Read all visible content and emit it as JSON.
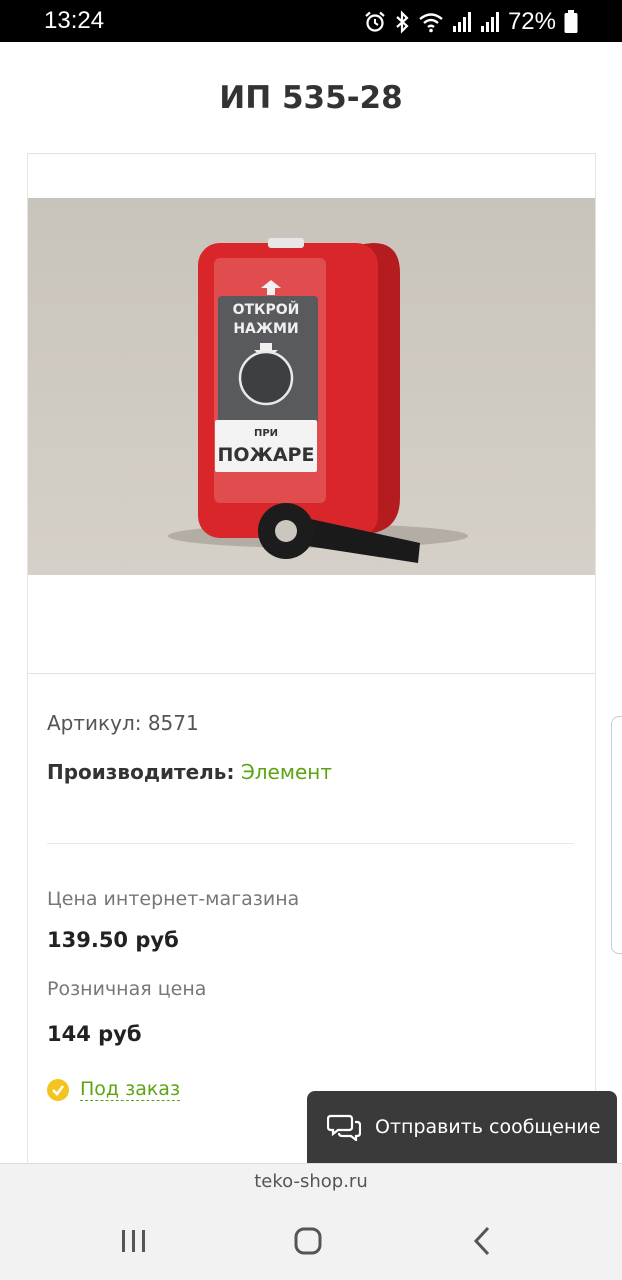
{
  "status_bar": {
    "time": "13:24",
    "battery_percent": "72%",
    "icons": [
      "alarm-icon",
      "bluetooth-icon",
      "wifi-icon",
      "signal-icon",
      "signal-icon",
      "battery-icon"
    ]
  },
  "product": {
    "title": "ИП 535-28",
    "image": {
      "label_top": "ОТКРОЙ",
      "label_middle": "НАЖМИ",
      "label_small": "ПРИ",
      "label_big": "ПОЖАРЕ"
    },
    "sku_text": "Артикул: 8571",
    "manufacturer_label": "Производитель:",
    "manufacturer_name": "Элемент",
    "price_online_label": "Цена интернет-магазина",
    "price_online": "139.50 руб",
    "price_retail_label": "Розничная цена",
    "price_retail": "144 руб",
    "availability": "Под заказ"
  },
  "chat": {
    "label": "Отправить сообщение",
    "icon": "chat-bubbles-icon"
  },
  "browser": {
    "url": "teko-shop.ru"
  },
  "nav": {
    "icons": [
      "recent-apps-icon",
      "home-icon",
      "back-icon"
    ]
  },
  "colors": {
    "accent_green": "#5aa511",
    "availability_yellow": "#f3c31e",
    "chat_bg": "#3a3a3a",
    "device_red": "#d8262a"
  }
}
